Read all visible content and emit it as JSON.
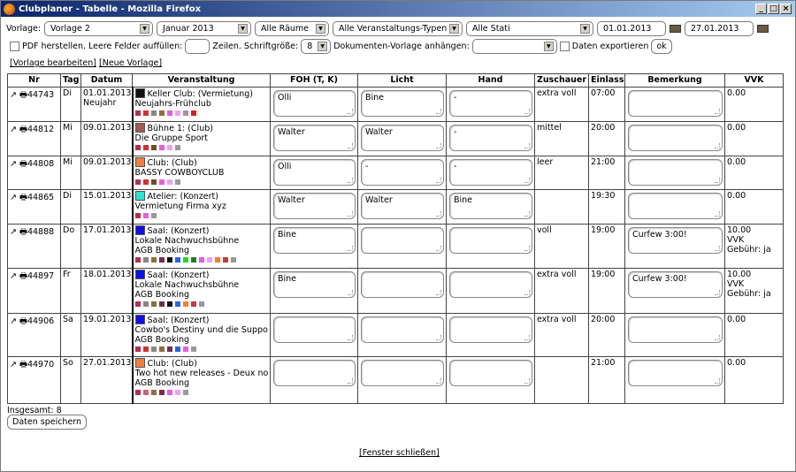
{
  "window": {
    "title": "Clubplaner - Tabelle - Mozilla Firefox"
  },
  "filters": {
    "vorlage_label": "Vorlage:",
    "vorlage": "Vorlage 2",
    "monat": "Januar 2013",
    "raeume": "Alle Räume",
    "typen": "Alle Veranstaltungs-Typen",
    "stati": "Alle Stati",
    "von": "01.01.2013",
    "bis": "27.01.2013"
  },
  "options": {
    "pdf_label": "PDF herstellen. Leere Felder auffüllen:",
    "zeilen_label": "Zeilen. Schriftgröße:",
    "schrift": "8",
    "dokument_label": "Dokumenten-Vorlage anhängen:",
    "export_label": "Daten exportieren",
    "ok": "ok"
  },
  "links": {
    "bearbeiten": "[Vorlage bearbeiten]",
    "neu": "[Neue Vorlage]"
  },
  "columns": [
    "Nr",
    "Tag",
    "Datum",
    "Veranstaltung",
    "FOH (T, K)",
    "Licht",
    "Hand",
    "Zuschauer",
    "Einlass",
    "Bemerkung",
    "VVK"
  ],
  "rows": [
    {
      "nr": "44743",
      "tag": "Di",
      "datum": "01.01.2013",
      "datum2": "Neujahr",
      "color": "#111111",
      "ort": "Keller Club: (Vermietung)",
      "lines": [
        "Neujahrs-Frühclub"
      ],
      "icons": [
        "#b03050",
        "#d03030",
        "#888",
        "#8a7040",
        "#e060e0",
        "#f0a0f0",
        "#999",
        "#d02020"
      ],
      "foh": "Olli",
      "licht": "Bine",
      "hand": "-",
      "zuschauer": "extra voll",
      "einlass": "07:00",
      "bemerkung": "",
      "vvk": [
        "0.00"
      ]
    },
    {
      "nr": "44812",
      "tag": "Mi",
      "datum": "09.01.2013",
      "datum2": "",
      "color": "#a05a50",
      "ort": "Bühne 1: (Club)",
      "lines": [
        "Die Gruppe Sport"
      ],
      "icons": [
        "#b03050",
        "#d03030",
        "#6a5020",
        "#e060e0",
        "#f0a0f0",
        "#999"
      ],
      "foh": "Walter",
      "licht": "Walter",
      "hand": "-",
      "zuschauer": "mittel",
      "einlass": "20:00",
      "bemerkung": "",
      "vvk": [
        "0.00"
      ]
    },
    {
      "nr": "44808",
      "tag": "Mi",
      "datum": "09.01.2013",
      "datum2": "",
      "color": "#f08040",
      "ort": "Club: (Club)",
      "lines": [
        "BASSY COWBOYCLUB"
      ],
      "icons": [
        "#b03050",
        "#d03030",
        "#6a5020",
        "#e060e0",
        "#f0a0f0",
        "#999"
      ],
      "foh": "Olli",
      "licht": "-",
      "hand": "-",
      "zuschauer": "leer",
      "einlass": "21:00",
      "bemerkung": "",
      "vvk": [
        "0.00"
      ]
    },
    {
      "nr": "44865",
      "tag": "Di",
      "datum": "15.01.2013",
      "datum2": "",
      "color": "#30e0d0",
      "ort": "Atelier: (Konzert)",
      "lines": [
        "Vermietung Firma xyz"
      ],
      "icons": [
        "#b03050",
        "#e060e0",
        "#999"
      ],
      "foh": "Walter",
      "licht": "Walter",
      "hand": "Bine",
      "zuschauer": "",
      "einlass": "19:30",
      "bemerkung": "",
      "vvk": [
        "0.00"
      ]
    },
    {
      "nr": "44888",
      "tag": "Do",
      "datum": "17.01.2013",
      "datum2": "",
      "color": "#1010e0",
      "ort": "Saal: (Konzert)",
      "lines": [
        "Lokale Nachwuchsbühne",
        "AGB Booking"
      ],
      "icons": [
        "#b03050",
        "#888",
        "#8a7040",
        "#703050",
        "#111",
        "#3060e0",
        "#30d030",
        "#208020",
        "#e060e0",
        "#f0a0f0",
        "#f08030",
        "#c04040",
        "#999"
      ],
      "foh": "Bine",
      "licht": "",
      "hand": "",
      "zuschauer": "voll",
      "einlass": "19:00",
      "bemerkung": "Curfew 3:00!",
      "vvk": [
        "10.00",
        "VVK",
        "Gebühr: ja"
      ]
    },
    {
      "nr": "44897",
      "tag": "Fr",
      "datum": "18.01.2013",
      "datum2": "",
      "color": "#1010e0",
      "ort": "Saal: (Konzert)",
      "lines": [
        "Lokale Nachwuchsbühne",
        "AGB Booking"
      ],
      "icons": [
        "#b03050",
        "#888",
        "#8a7040",
        "#703050",
        "#111",
        "#3060e0",
        "#f08030",
        "#c04040",
        "#999"
      ],
      "foh": "Bine",
      "licht": "",
      "hand": "",
      "zuschauer": "extra voll",
      "einlass": "19:00",
      "bemerkung": "Curfew 3:00!",
      "vvk": [
        "10.00",
        "VVK",
        "Gebühr: ja"
      ]
    },
    {
      "nr": "44906",
      "tag": "Sa",
      "datum": "19.01.2013",
      "datum2": "",
      "color": "#1010e0",
      "ort": "Saal: (Konzert)",
      "lines": [
        "Cowbo's Destiny und die Suppor",
        "AGB Booking"
      ],
      "icons": [
        "#b03050",
        "#d03030",
        "#888",
        "#8a7040",
        "#703050",
        "#3060e0",
        "#e060e0",
        "#999"
      ],
      "foh": "",
      "licht": "",
      "hand": "",
      "zuschauer": "extra voll",
      "einlass": "20:00",
      "bemerkung": "",
      "vvk": [
        "0.00"
      ]
    },
    {
      "nr": "44970",
      "tag": "So",
      "datum": "27.01.2013",
      "datum2": "",
      "color": "#f08040",
      "ort": "Club: (Club)",
      "lines": [
        "Two hot new releases - Deux no",
        "AGB Booking"
      ],
      "icons": [
        "#b03050",
        "#d06080",
        "#8a7040",
        "#703050",
        "#e060e0",
        "#f0a0f0",
        "#999"
      ],
      "foh": "",
      "licht": "",
      "hand": "",
      "zuschauer": "",
      "einlass": "21:00",
      "bemerkung": "",
      "vvk": [
        "0.00"
      ]
    }
  ],
  "footer": {
    "total": "Insgesamt: 8",
    "save": "Daten speichern",
    "close": "[Fenster schließen]"
  }
}
